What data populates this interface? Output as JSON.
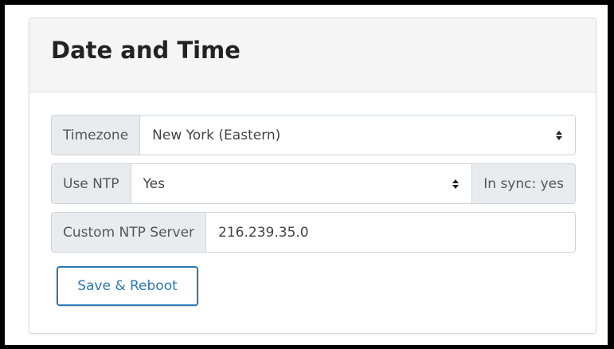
{
  "panel": {
    "title": "Date and Time"
  },
  "timezone": {
    "label": "Timezone",
    "selected": "New York (Eastern)"
  },
  "ntp": {
    "label": "Use NTP",
    "selected": "Yes",
    "sync_status": "In sync: yes"
  },
  "custom_ntp": {
    "label": "Custom NTP Server",
    "value": "216.239.35.0"
  },
  "actions": {
    "save_label": "Save & Reboot"
  },
  "colors": {
    "accent": "#2e78b7",
    "addon_background": "#e9ecef",
    "heading_background": "#f5f5f5"
  }
}
